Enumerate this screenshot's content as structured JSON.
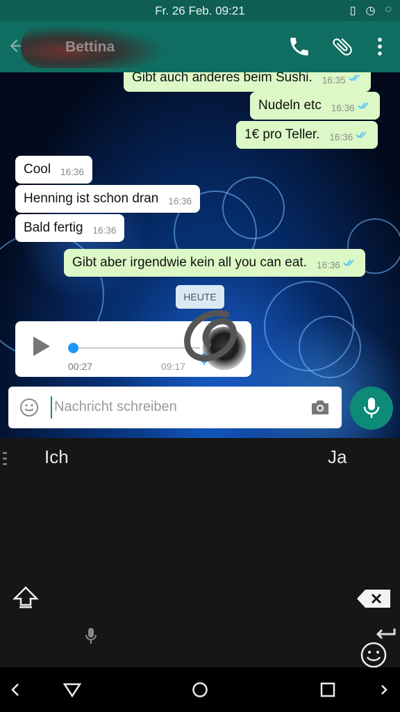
{
  "status_bar": {
    "datetime": "Fr. 26 Feb. 09:21"
  },
  "header": {
    "contact_name": "Bettina"
  },
  "messages": [
    {
      "text": "Gibt auch anderes beim Sushi.",
      "time": "16:35",
      "dir": "out"
    },
    {
      "text": "Nudeln etc",
      "time": "16:36",
      "dir": "out"
    },
    {
      "text": "1€ pro Teller.",
      "time": "16:36",
      "dir": "out"
    },
    {
      "text": "Cool",
      "time": "16:36",
      "dir": "in"
    },
    {
      "text": "Henning ist schon dran",
      "time": "16:36",
      "dir": "in"
    },
    {
      "text": "Bald fertig",
      "time": "16:36",
      "dir": "in"
    },
    {
      "text": "Gibt aber irgendwie kein all you can eat.",
      "time": "16:36",
      "dir": "out"
    }
  ],
  "date_chip": "HEUTE",
  "voice_message": {
    "current": "00:27",
    "duration": "09:17",
    "progress": 0
  },
  "composer": {
    "placeholder": "Nachricht schreiben"
  },
  "keyboard": {
    "suggestions": [
      "Ich",
      "Ja"
    ]
  },
  "colors": {
    "header": "#0f6e61",
    "outgoing": "#dcf8c6",
    "incoming": "#ffffff",
    "fab": "#0e8a78",
    "tick": "#4fc3f7"
  }
}
